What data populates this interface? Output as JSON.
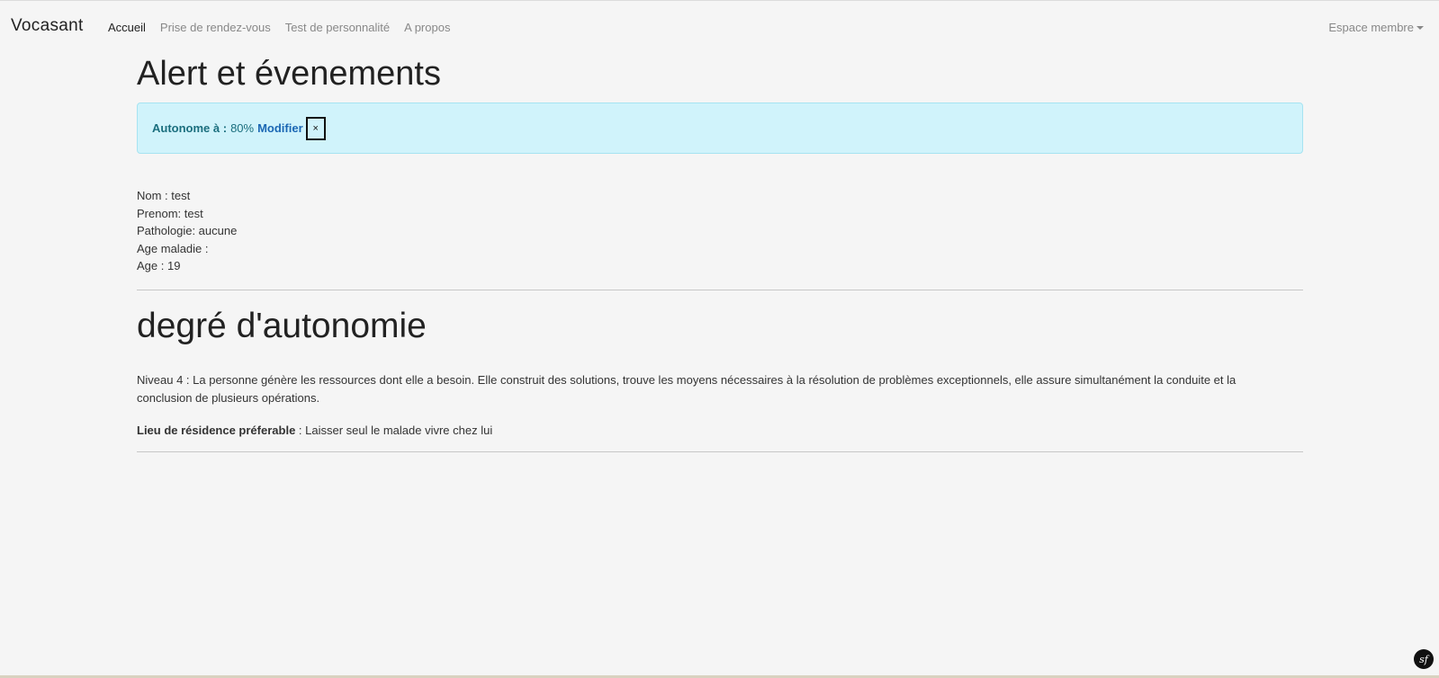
{
  "navbar": {
    "brand": "Vocasant",
    "links": [
      {
        "label": "Accueil"
      },
      {
        "label": "Prise de rendez-vous"
      },
      {
        "label": "Test de personnalité"
      },
      {
        "label": "A propos"
      }
    ],
    "member_menu": "Espace membre",
    "colors": {
      "active": "#222222",
      "inactive": "#888888"
    }
  },
  "main": {
    "title": "Alert et évenements",
    "alert": {
      "label": "Autonome à :",
      "value": "80%",
      "action": "Modifier",
      "close": "×",
      "colors": {
        "background": "#d0f3fb",
        "border": "#a6e3f1",
        "text": "#1a6e7e",
        "link": "#1b67b4"
      }
    },
    "info": {
      "nom": "Nom : test",
      "prenom": "Prenom: test",
      "pathologie": "Pathologie: aucune",
      "age_maladie": "Age maladie :",
      "age": "Age : 19"
    },
    "section_title": "degré d'autonomie",
    "description": "Niveau 4 : La personne génère les ressources dont elle a besoin. Elle construit des solutions, trouve les moyens nécessaires à la résolution de problèmes exceptionnels, elle assure simultanément la conduite et la conclusion de plusieurs opérations.",
    "residence": {
      "label": "Lieu de résidence préferable",
      "value": " : Laisser seul le malade vivre chez lui"
    }
  },
  "debug_toolbar": {
    "icon": "symfony-logo-icon",
    "text": "sf"
  }
}
